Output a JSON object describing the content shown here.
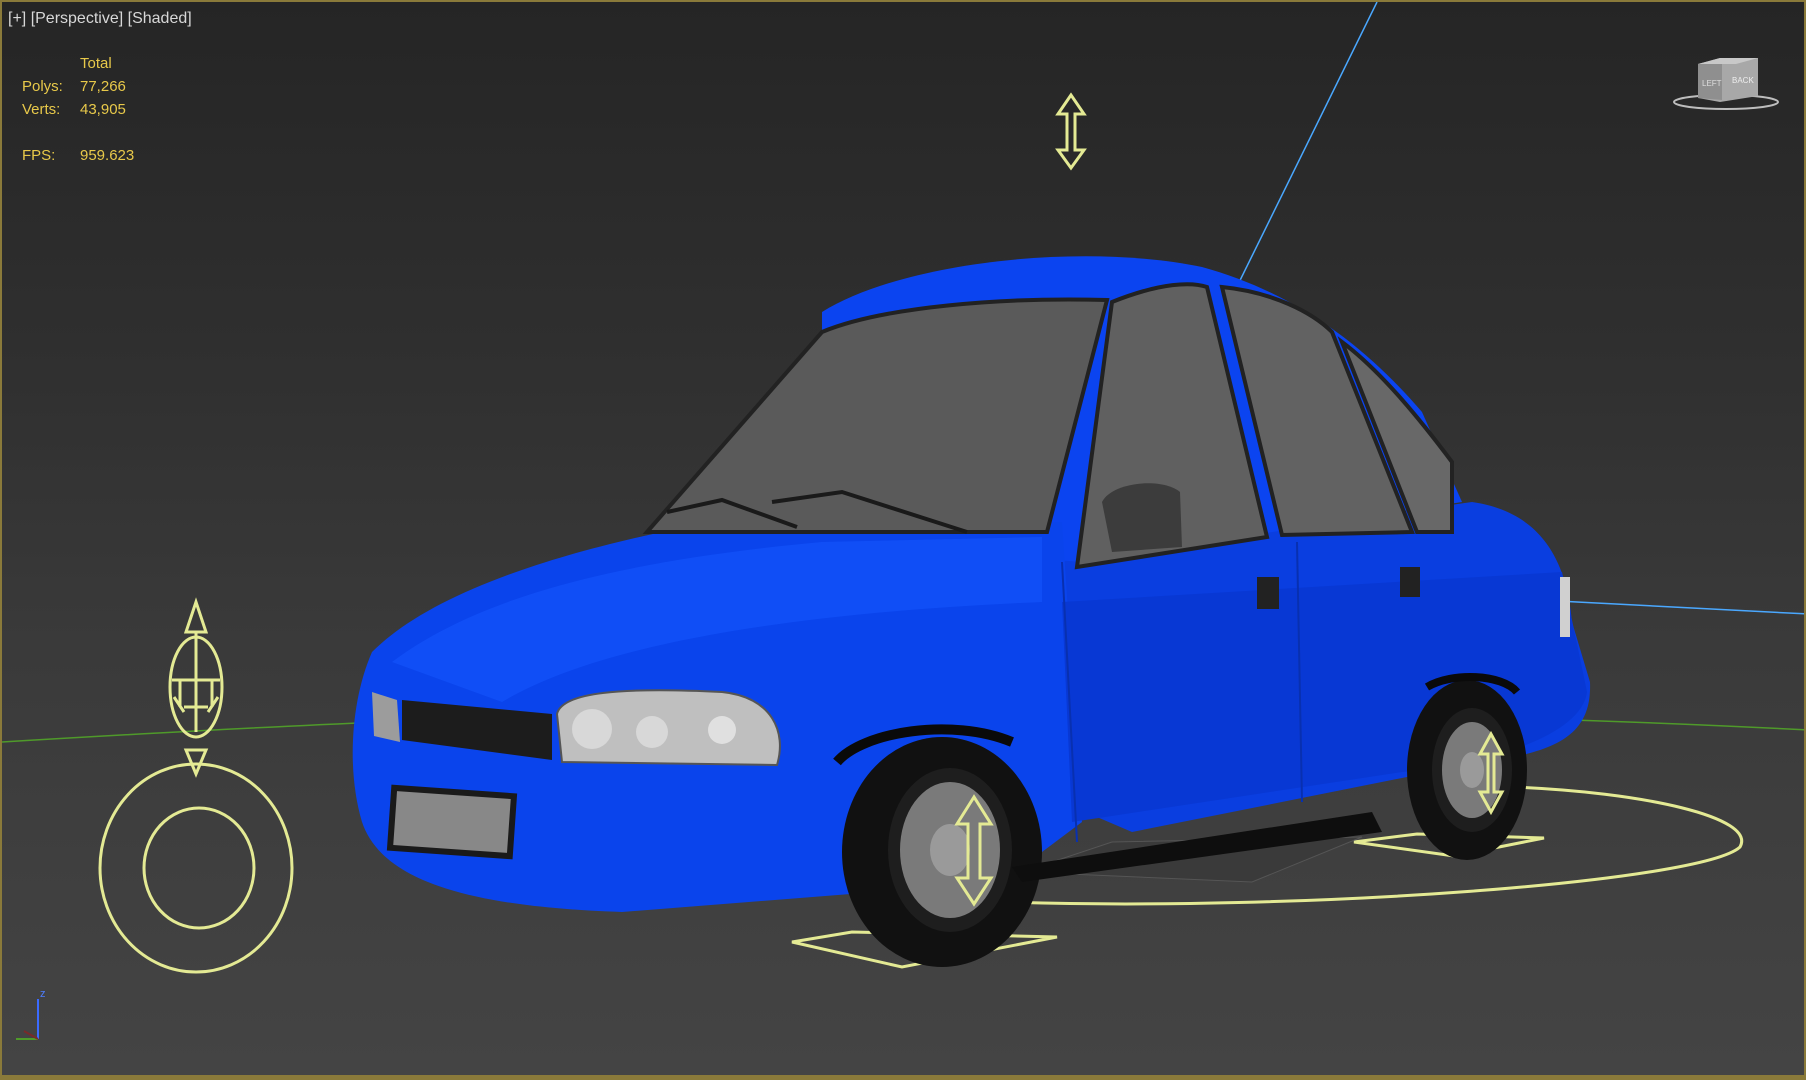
{
  "viewport": {
    "label_plus": "[+]",
    "label_view": "[Perspective]",
    "label_shading": "[Shaded]"
  },
  "stats": {
    "header": "Total",
    "polys_label": "Polys:",
    "polys_value": "77,266",
    "verts_label": "Verts:",
    "verts_value": "43,905",
    "fps_label": "FPS:",
    "fps_value": "959.623"
  },
  "viewcube": {
    "left_face": "LEFT",
    "front_face": "BACK"
  },
  "axis": {
    "z_label": "z"
  },
  "colors": {
    "car_body": "#0a40e8",
    "gizmo": "#e4ea94",
    "stats_text": "#e8c94a",
    "selection_axis": "#4aa8ff",
    "grid_line": "#4f9a2a"
  },
  "icons": {
    "gizmo_top": "double-arrow-vertical-icon",
    "gizmo_left": "root-control-icon",
    "wheel_gizmos": "wheel-arrow-icon"
  }
}
